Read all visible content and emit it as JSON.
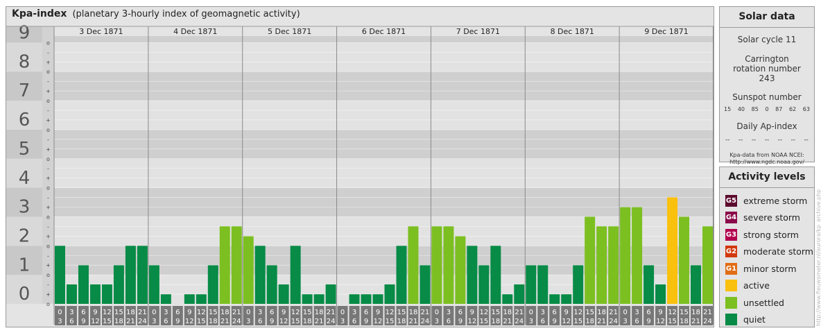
{
  "title": "Kpa-index",
  "subtitle": "(planetary 3-hourly index of geomagnetic activity)",
  "colors": {
    "quiet": "#078b46",
    "unsettled": "#7cbf21",
    "active": "#fac00e",
    "minor_storm": "#e16d13",
    "moderate_storm": "#d2380e",
    "strong_storm": "#b3004f",
    "severe_storm": "#8a0a4a",
    "extreme_storm": "#5c0a2e"
  },
  "chart_data": {
    "type": "bar",
    "title": "Kpa-index",
    "ylim": [
      0,
      9
    ],
    "y_ticks": [
      "0",
      "1",
      "2",
      "3",
      "4",
      "5",
      "6",
      "7",
      "8",
      "9"
    ],
    "sub_ticks": [
      "-",
      "o",
      "+"
    ],
    "time_labels_top": [
      "0",
      "3",
      "6",
      "9",
      "12",
      "15",
      "18",
      "21"
    ],
    "time_labels_bottom": [
      "3",
      "6",
      "9",
      "12",
      "15",
      "18",
      "21",
      "24"
    ],
    "days": [
      {
        "date": "3 Dec 1871",
        "values": [
          2.0,
          0.67,
          1.33,
          0.67,
          0.67,
          1.33,
          2.0,
          2.0
        ]
      },
      {
        "date": "4 Dec 1871",
        "values": [
          1.33,
          0.33,
          0.0,
          0.33,
          0.33,
          1.33,
          2.67,
          2.67
        ]
      },
      {
        "date": "5 Dec 1871",
        "values": [
          2.33,
          2.0,
          1.33,
          0.67,
          2.0,
          0.33,
          0.33,
          0.67
        ]
      },
      {
        "date": "6 Dec 1871",
        "values": [
          0.0,
          0.33,
          0.33,
          0.33,
          0.67,
          2.0,
          2.67,
          1.33
        ]
      },
      {
        "date": "7 Dec 1871",
        "values": [
          2.67,
          2.67,
          2.33,
          2.0,
          1.33,
          2.0,
          0.33,
          0.67
        ]
      },
      {
        "date": "8 Dec 1871",
        "values": [
          1.33,
          1.33,
          0.33,
          0.33,
          1.33,
          3.0,
          2.67,
          2.67
        ]
      },
      {
        "date": "9 Dec 1871",
        "values": [
          3.33,
          3.33,
          1.33,
          0.67,
          3.67,
          3.0,
          1.33,
          2.67
        ]
      }
    ],
    "levels": [
      {
        "name": "quiet",
        "max": 2.0
      },
      {
        "name": "unsettled",
        "max": 3.33
      },
      {
        "name": "active",
        "max": 4.67
      }
    ]
  },
  "solar": {
    "title": "Solar data",
    "cycle": "Solar cycle 11",
    "carrington": "Carrington rotation number 243",
    "sunspot_title": "Sunspot number",
    "sunspots": [
      "15",
      "40",
      "85",
      "0",
      "87",
      "62",
      "63"
    ],
    "ap_title": "Daily Ap-index",
    "ap_values": [
      "--",
      "--",
      "--",
      "--",
      "--",
      "--",
      "--"
    ],
    "credit_line1": "Kpa-data from NOAA NCEI:",
    "credit_line2": "http://www.ngdc.noaa.gov/"
  },
  "activity": {
    "title": "Activity levels",
    "items": [
      {
        "badge": "G5",
        "label": "extreme storm",
        "color": "#5c0a2e"
      },
      {
        "badge": "G4",
        "label": "severe storm",
        "color": "#8a0a4a"
      },
      {
        "badge": "G3",
        "label": "strong storm",
        "color": "#b3004f"
      },
      {
        "badge": "G2",
        "label": "moderate storm",
        "color": "#d2380e"
      },
      {
        "badge": "G1",
        "label": "minor storm",
        "color": "#e16d13"
      },
      {
        "badge": "",
        "label": "active",
        "color": "#fac00e"
      },
      {
        "badge": "",
        "label": "unsettled",
        "color": "#7cbf21"
      },
      {
        "badge": "",
        "label": "quiet",
        "color": "#078b46"
      }
    ]
  },
  "side_url": "http://www.fieuwsmeter.nl/aurora/kp_archive.php"
}
